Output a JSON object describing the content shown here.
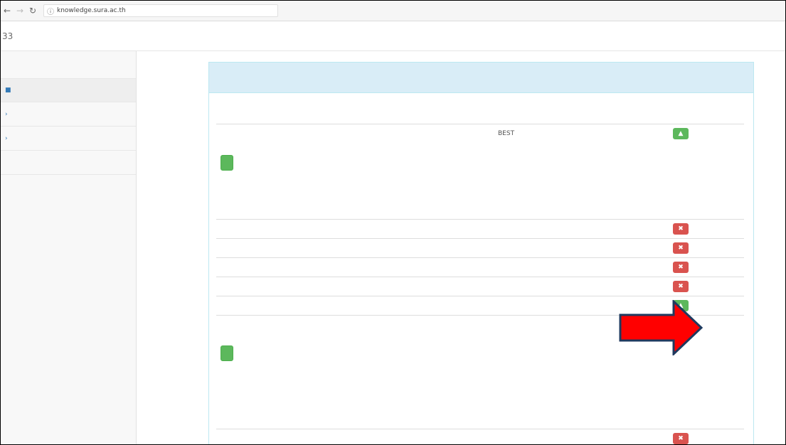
{
  "browser": {
    "url_host": "knowledge.sura.ac.th",
    "url_rest": ""
  },
  "site": {
    "brand": "33"
  },
  "sidebar": {
    "items": [
      {
        "label": "",
        "icon": "home-icon"
      },
      {
        "label": ""
      },
      {
        "label": ""
      },
      {
        "label": ""
      }
    ]
  },
  "panel": {
    "heading": "",
    "sections": [
      {
        "title": "",
        "rows": [
          {
            "name": "",
            "title": "BEST",
            "action": "green",
            "icon": "lock-icon"
          }
        ],
        "add_label": ""
      },
      {
        "title": "",
        "rows": [
          {
            "name": "",
            "title": "",
            "action": "red",
            "icon": "remove-icon"
          },
          {
            "name": "",
            "title": "",
            "action": "red",
            "icon": "remove-icon"
          },
          {
            "name": "",
            "title": "",
            "action": "red",
            "icon": "remove-icon"
          },
          {
            "name": "",
            "title": "",
            "action": "red",
            "icon": "remove-icon"
          },
          {
            "name": "",
            "title": "",
            "action": "green",
            "icon": "lock-icon"
          },
          {
            "name": "",
            "title": "",
            "action": "red",
            "icon": "remove-icon"
          }
        ],
        "add_label": ""
      },
      {
        "title": "",
        "rows": [
          {
            "name": "",
            "title": "",
            "action": "red",
            "icon": "remove-icon"
          }
        ]
      }
    ]
  },
  "colors": {
    "green": "#5cb85c",
    "red": "#d9534f",
    "panel_heading_bg": "#d9edf7",
    "arrow": "#ff0000"
  }
}
